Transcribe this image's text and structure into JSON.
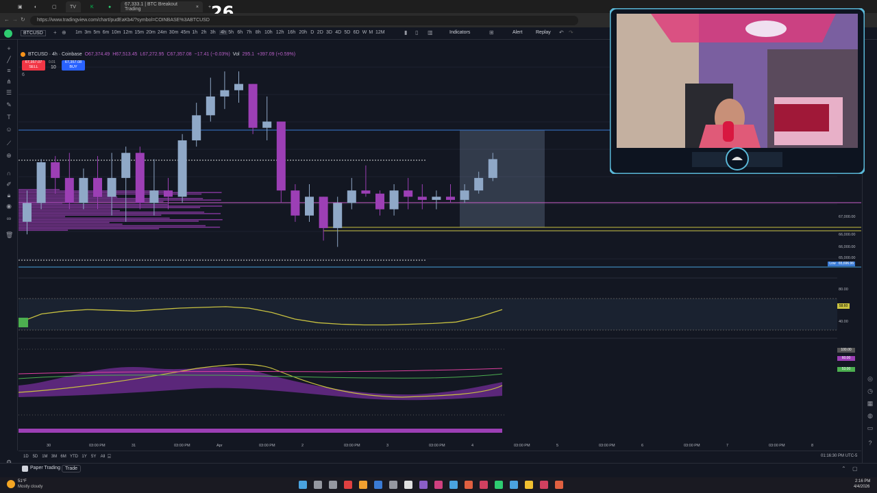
{
  "browser": {
    "tab_title": "67,333.1 | BTC Breakout Trading",
    "url": "https://www.tradingview.com/chart/pudEaKb4/?symbol=COINBASE%3ABTCUSD",
    "overlay_counter": "26"
  },
  "toolbar": {
    "symbol": "BTCUSD",
    "timeframes": [
      "1m",
      "3m",
      "5m",
      "6m",
      "10m",
      "12m",
      "15m",
      "20m",
      "24m",
      "30m",
      "45m",
      "1h",
      "2h",
      "3h",
      "4h",
      "5h",
      "6h",
      "7h",
      "8h",
      "10h",
      "12h",
      "16h",
      "20h",
      "D",
      "2D",
      "3D",
      "4D",
      "5D",
      "6D",
      "W",
      "M",
      "12M"
    ],
    "selected_timeframe": "4h",
    "indicators_label": "Indicators",
    "alert_label": "Alert",
    "replay_label": "Replay"
  },
  "legend": {
    "title": "BTCUSD · 4h · Coinbase",
    "open": "O67,374.49",
    "high": "H67,513.45",
    "low": "L67,272.95",
    "close": "C67,357.08",
    "change": "−17.41 (−0.03%)",
    "vol_label": "Vol",
    "vol": "295.1",
    "vol_change": "+397.09 (+0.59%)",
    "indicator_count": "6"
  },
  "order": {
    "sell_price": "67,357.07",
    "sell_label": "SELL",
    "buy_price": "67,357.08",
    "buy_label": "BUY",
    "spread": "0.01",
    "qty": "10"
  },
  "price_axis": {
    "labels": [
      "67,000.00",
      "66,000.00",
      "66,000.00",
      "65,000.00",
      "80.00",
      "40.00",
      "100.00",
      "60.00",
      "53.00"
    ],
    "low_label": "Low",
    "low_value": "65,696.96",
    "osc_value": "58.60"
  },
  "time_axis": [
    "30",
    "03:00 PM",
    "31",
    "03:00 PM",
    "Apr",
    "03:00 PM",
    "2",
    "03:00 PM",
    "3",
    "03:00 PM",
    "4",
    "03:00 PM",
    "5",
    "03:00 PM",
    "6",
    "03:00 PM",
    "7",
    "03:00 PM",
    "8"
  ],
  "range_bar": {
    "ranges": [
      "1D",
      "5D",
      "1M",
      "3M",
      "6M",
      "YTD",
      "1Y",
      "5Y",
      "All"
    ],
    "clock": "01:16:30 PM UTC-5"
  },
  "bottom": {
    "paper_trading": "Paper Trading",
    "trade": "Trade"
  },
  "taskbar": {
    "temp": "51°F",
    "weather": "Mostly cloudy",
    "time": "2:16 PM",
    "date": "4/4/2026"
  },
  "colors": {
    "bull": "#8fa8c7",
    "bear": "#9c3fb5",
    "bg": "#131722",
    "signal": "#c9c240",
    "level": "#3a7bd5"
  },
  "chart_data": {
    "type": "candlestick",
    "symbol": "BTCUSD",
    "timeframe": "4h",
    "candles": [
      {
        "o": 66300,
        "h": 66800,
        "l": 66100,
        "c": 66600
      },
      {
        "o": 66600,
        "h": 67300,
        "l": 66500,
        "c": 67250
      },
      {
        "o": 67250,
        "h": 67350,
        "l": 66750,
        "c": 67000
      },
      {
        "o": 67000,
        "h": 67400,
        "l": 66500,
        "c": 66600
      },
      {
        "o": 66600,
        "h": 67150,
        "l": 66500,
        "c": 67000
      },
      {
        "o": 67000,
        "h": 67350,
        "l": 66500,
        "c": 66700
      },
      {
        "o": 66700,
        "h": 67400,
        "l": 66400,
        "c": 67000
      },
      {
        "o": 67000,
        "h": 67500,
        "l": 66300,
        "c": 67400
      },
      {
        "o": 67400,
        "h": 67500,
        "l": 66500,
        "c": 66600
      },
      {
        "o": 66600,
        "h": 67300,
        "l": 66400,
        "c": 66800
      },
      {
        "o": 66800,
        "h": 67000,
        "l": 66500,
        "c": 66700
      },
      {
        "o": 66700,
        "h": 67700,
        "l": 66600,
        "c": 67600
      },
      {
        "o": 67600,
        "h": 68200,
        "l": 67500,
        "c": 68000
      },
      {
        "o": 68000,
        "h": 68600,
        "l": 67900,
        "c": 68300
      },
      {
        "o": 68300,
        "h": 68700,
        "l": 68100,
        "c": 68400
      },
      {
        "o": 68400,
        "h": 68700,
        "l": 68200,
        "c": 68500
      },
      {
        "o": 68500,
        "h": 68500,
        "l": 67700,
        "c": 67800
      },
      {
        "o": 67800,
        "h": 68300,
        "l": 67600,
        "c": 67900
      },
      {
        "o": 67900,
        "h": 67900,
        "l": 66600,
        "c": 66800
      },
      {
        "o": 66800,
        "h": 66900,
        "l": 66300,
        "c": 66400
      },
      {
        "o": 66400,
        "h": 66900,
        "l": 66300,
        "c": 66700
      },
      {
        "o": 66700,
        "h": 66700,
        "l": 66000,
        "c": 66200
      },
      {
        "o": 66200,
        "h": 66700,
        "l": 65900,
        "c": 66600
      },
      {
        "o": 66600,
        "h": 67000,
        "l": 66500,
        "c": 66800
      },
      {
        "o": 66800,
        "h": 67200,
        "l": 66700,
        "c": 66750
      },
      {
        "o": 66750,
        "h": 66800,
        "l": 66400,
        "c": 66500
      },
      {
        "o": 66500,
        "h": 66900,
        "l": 66400,
        "c": 66800
      },
      {
        "o": 66800,
        "h": 67000,
        "l": 66500,
        "c": 66700
      },
      {
        "o": 66700,
        "h": 66900,
        "l": 66500,
        "c": 66650
      },
      {
        "o": 66650,
        "h": 66800,
        "l": 66500,
        "c": 66700
      },
      {
        "o": 66700,
        "h": 66900,
        "l": 66600,
        "c": 66650
      },
      {
        "o": 66650,
        "h": 66900,
        "l": 66600,
        "c": 66800
      },
      {
        "o": 66800,
        "h": 67100,
        "l": 66750,
        "c": 67000
      },
      {
        "o": 67000,
        "h": 67400,
        "l": 66950,
        "c": 67300
      }
    ],
    "price_range": [
      65600,
      68900
    ],
    "oscillator": [
      30,
      42,
      46,
      48,
      47,
      46,
      48,
      50,
      51,
      52,
      50,
      44,
      35,
      30,
      28,
      27,
      27,
      28,
      29,
      31,
      38,
      48
    ],
    "osc_range": [
      20,
      80
    ]
  }
}
